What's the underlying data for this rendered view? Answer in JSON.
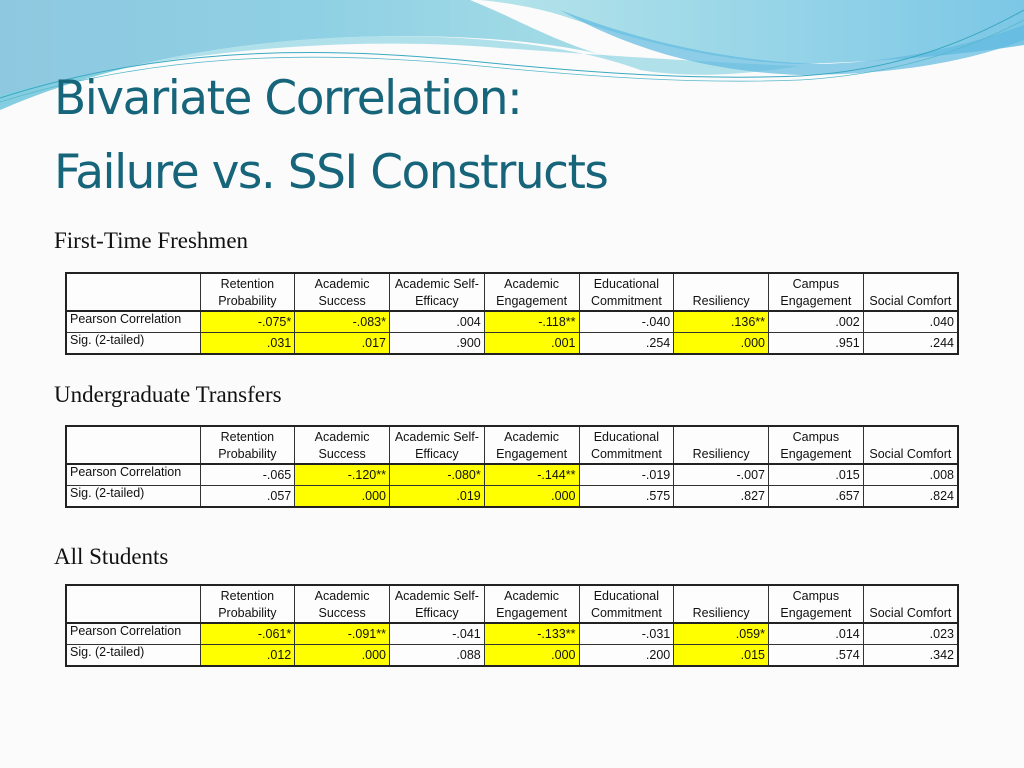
{
  "slide": {
    "title_line1": "Bivariate Correlation:",
    "title_line2": "Failure vs. SSI Constructs",
    "highlight_color": "#ffff00",
    "title_color": "#17657a"
  },
  "columns": [
    "Retention Probability",
    "Academic Success",
    "Academic Self-Efficacy",
    "Academic Engagement",
    "Educational Commitment",
    "Resiliency",
    "Campus Engagement",
    "Social Comfort"
  ],
  "column_lines": [
    [
      "Retention",
      "Probability"
    ],
    [
      "Academic",
      "Success"
    ],
    [
      "Academic Self-",
      "Efficacy"
    ],
    [
      "Academic",
      "Engagement"
    ],
    [
      "Educational",
      "Commitment"
    ],
    [
      "",
      "Resiliency"
    ],
    [
      "Campus",
      "Engagement"
    ],
    [
      "",
      "Social Comfort"
    ]
  ],
  "row_labels": [
    "Pearson Correlation",
    "Sig. (2-tailed)"
  ],
  "tables": [
    {
      "label": "First-Time Freshmen",
      "pearson": [
        "-.075*",
        "-.083*",
        ".004",
        "-.118**",
        "-.040",
        ".136**",
        ".002",
        ".040"
      ],
      "sig": [
        ".031",
        ".017",
        ".900",
        ".001",
        ".254",
        ".000",
        ".951",
        ".244"
      ],
      "highlighted": [
        true,
        true,
        false,
        true,
        false,
        true,
        false,
        false
      ]
    },
    {
      "label": "Undergraduate Transfers",
      "pearson": [
        "-.065",
        "-.120**",
        "-.080*",
        "-.144**",
        "-.019",
        "-.007",
        ".015",
        ".008"
      ],
      "sig": [
        ".057",
        ".000",
        ".019",
        ".000",
        ".575",
        ".827",
        ".657",
        ".824"
      ],
      "highlighted": [
        false,
        true,
        true,
        true,
        false,
        false,
        false,
        false
      ]
    },
    {
      "label": "All Students",
      "pearson": [
        "-.061*",
        "-.091**",
        "-.041",
        "-.133**",
        "-.031",
        ".059*",
        ".014",
        ".023"
      ],
      "sig": [
        ".012",
        ".000",
        ".088",
        ".000",
        ".200",
        ".015",
        ".574",
        ".342"
      ],
      "highlighted": [
        true,
        true,
        false,
        true,
        false,
        true,
        false,
        false
      ]
    }
  ]
}
